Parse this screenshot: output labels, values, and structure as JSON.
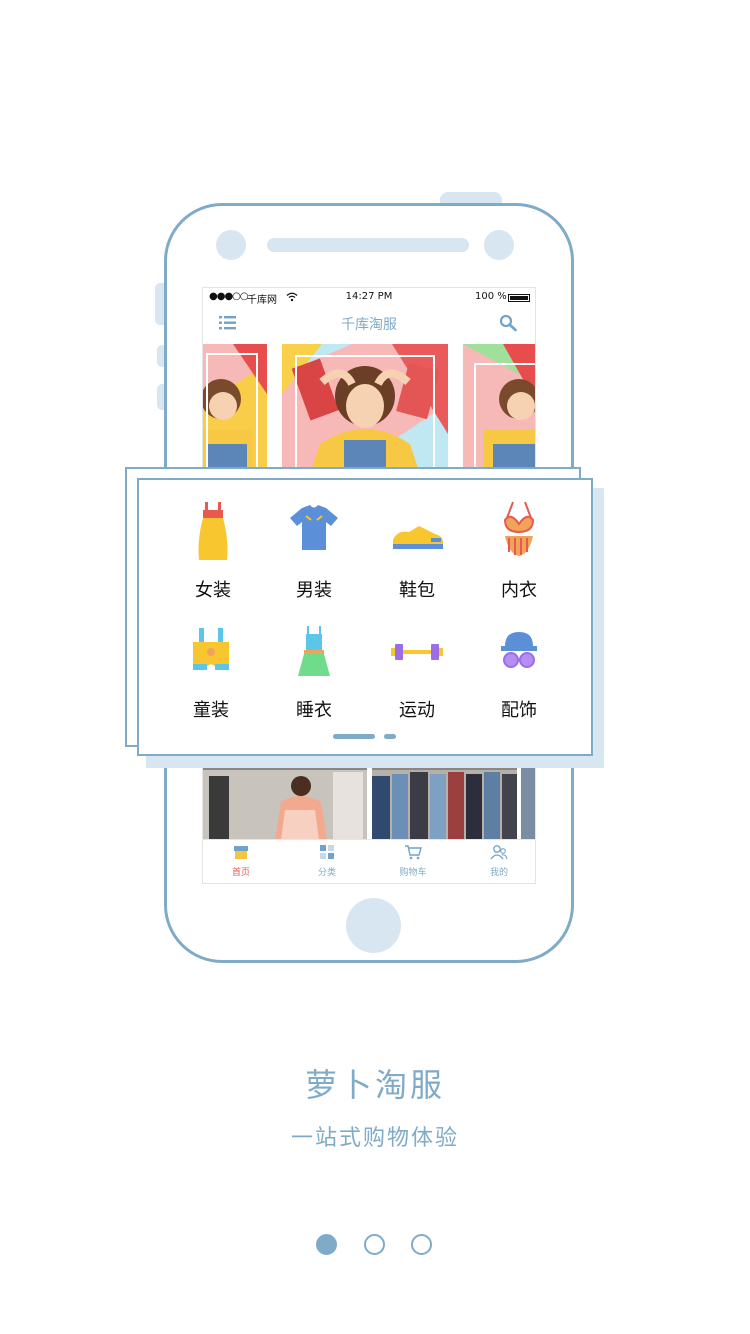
{
  "colors": {
    "accent": "#7fabc8",
    "accent_light": "#d8e6f1",
    "active_tab": "#e85a4f"
  },
  "phone_screen": {
    "status_bar": {
      "signal": "●●●○○",
      "carrier": "千库网",
      "wifi_icon": "wifi-icon",
      "time": "14:27 PM",
      "battery": "100 %"
    },
    "nav": {
      "title": "千库淘服",
      "menu_icon": "list-icon",
      "search_icon": "search-icon"
    },
    "tabs": [
      {
        "label": "首页",
        "icon": "home-icon",
        "active": true
      },
      {
        "label": "分类",
        "icon": "grid-icon",
        "active": false
      },
      {
        "label": "购物车",
        "icon": "cart-icon",
        "active": false
      },
      {
        "label": "我的",
        "icon": "user-icon",
        "active": false
      }
    ]
  },
  "categories": [
    {
      "label": "女装",
      "icon": "dress-icon"
    },
    {
      "label": "男装",
      "icon": "tshirt-icon"
    },
    {
      "label": "鞋包",
      "icon": "shoe-icon"
    },
    {
      "label": "内衣",
      "icon": "bikini-icon"
    },
    {
      "label": "童装",
      "icon": "kids-overall-icon"
    },
    {
      "label": "睡衣",
      "icon": "nightdress-icon"
    },
    {
      "label": "运动",
      "icon": "dumbbell-icon"
    },
    {
      "label": "配饰",
      "icon": "hat-glasses-icon"
    }
  ],
  "intro": {
    "app_name": "萝卜淘服",
    "tagline": "一站式购物体验"
  },
  "pager": {
    "count": 3,
    "active_index": 0
  }
}
